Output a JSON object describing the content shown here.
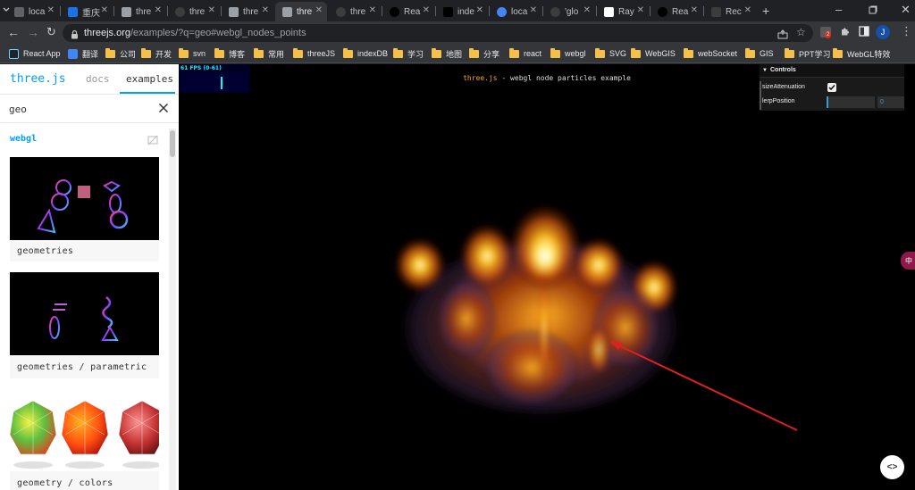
{
  "colors": {
    "chrome_bg": "#202124",
    "toolbar_bg": "#35363a",
    "accent": "#049ef4",
    "annotation_arrow": "#e02020",
    "stats_fg": "#00ffff",
    "info_link": "#ffa500"
  },
  "tabs": [
    {
      "label": "loca",
      "icon": "localhost-icon",
      "color": "#5f6368"
    },
    {
      "label": "重庆",
      "icon": "c-icon",
      "color": "#1a73e8"
    },
    {
      "label": "thre",
      "icon": "threejs-icon",
      "color": "#9aa0a6"
    },
    {
      "label": "thre",
      "icon": "github-icon",
      "color": "#3c3c3c"
    },
    {
      "label": "thre",
      "icon": "threejs-icon",
      "color": "#9aa0a6"
    },
    {
      "label": "thre",
      "icon": "threejs-icon",
      "color": "#9aa0a6",
      "active": true
    },
    {
      "label": "thre",
      "icon": "github-icon",
      "color": "#3c3c3c"
    },
    {
      "label": "Rea",
      "icon": "circle-icon",
      "color": "#000000"
    },
    {
      "label": "inde",
      "icon": "square-icon",
      "color": "#000000"
    },
    {
      "label": "loca",
      "icon": "globe-icon",
      "color": "#4285f4"
    },
    {
      "label": "'glo",
      "icon": "github-icon",
      "color": "#3c3c3c"
    },
    {
      "label": "Ray",
      "icon": "ray-icon",
      "color": "#ffffff"
    },
    {
      "label": "Rea",
      "icon": "circle-icon",
      "color": "#000000"
    },
    {
      "label": "Rec",
      "icon": "page-icon",
      "color": "#3c3c3c"
    }
  ],
  "toolbar": {
    "url_host": "threejs.org",
    "url_path": "/examples/?q=geo#webgl_nodes_points",
    "extension_badge": "2",
    "profile_initial": "J"
  },
  "bookmarks": [
    {
      "label": "React App",
      "type": "app"
    },
    {
      "label": "翻译",
      "type": "translate"
    },
    {
      "label": "公司",
      "type": "folder"
    },
    {
      "label": "开发",
      "type": "folder"
    },
    {
      "label": "svn",
      "type": "folder"
    },
    {
      "label": "博客",
      "type": "folder"
    },
    {
      "label": "常用",
      "type": "folder"
    },
    {
      "label": "threeJS",
      "type": "folder"
    },
    {
      "label": "indexDB",
      "type": "folder"
    },
    {
      "label": "学习",
      "type": "folder"
    },
    {
      "label": "地图",
      "type": "folder"
    },
    {
      "label": "分享",
      "type": "folder"
    },
    {
      "label": "react",
      "type": "folder"
    },
    {
      "label": "webgl",
      "type": "folder"
    },
    {
      "label": "SVG",
      "type": "folder"
    },
    {
      "label": "WebGIS",
      "type": "folder"
    },
    {
      "label": "webSocket",
      "type": "folder"
    },
    {
      "label": "GIS",
      "type": "folder"
    },
    {
      "label": "PPT学习",
      "type": "folder"
    },
    {
      "label": "WebGL特效",
      "type": "folder"
    }
  ],
  "sidebar": {
    "logo": "three.js",
    "nav_docs": "docs",
    "nav_examples": "examples",
    "search_value": "geo",
    "section": "webgl",
    "cards": [
      {
        "caption": "geometries"
      },
      {
        "caption": "geometries / parametric"
      },
      {
        "caption": "geometry / colors"
      }
    ]
  },
  "viewport": {
    "stats": "61 FPS (0-61)",
    "info_link": "three.js",
    "info_text": " - webgl node particles example",
    "gui": {
      "title": "Controls",
      "rows": [
        {
          "label": "sizeAttenuation",
          "checked": true
        },
        {
          "label": "lerpPosition",
          "value": "0"
        }
      ]
    },
    "side_tab": "中"
  }
}
